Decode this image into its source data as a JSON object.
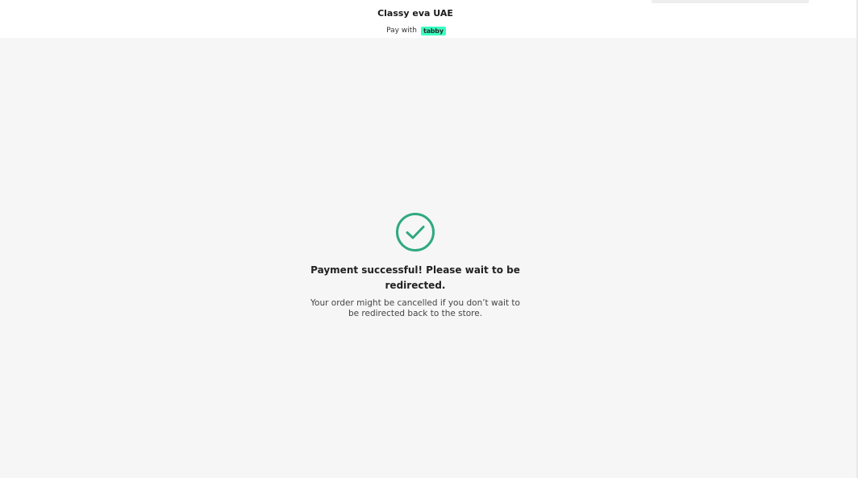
{
  "header": {
    "merchant_name": "Classy eva UAE",
    "pay_with_label": "Pay with",
    "provider_badge": "tabby"
  },
  "status": {
    "icon": "check-circle-icon",
    "title": "Payment successful! Please wait to be redirected.",
    "subtitle": "Your order might be cancelled if you don’t wait to be redirected back to the store."
  },
  "colors": {
    "page_background": "#f6f6f6",
    "header_background": "#ffffff",
    "success_green": "#2fa97d",
    "tabby_badge": "#3bffc1"
  }
}
